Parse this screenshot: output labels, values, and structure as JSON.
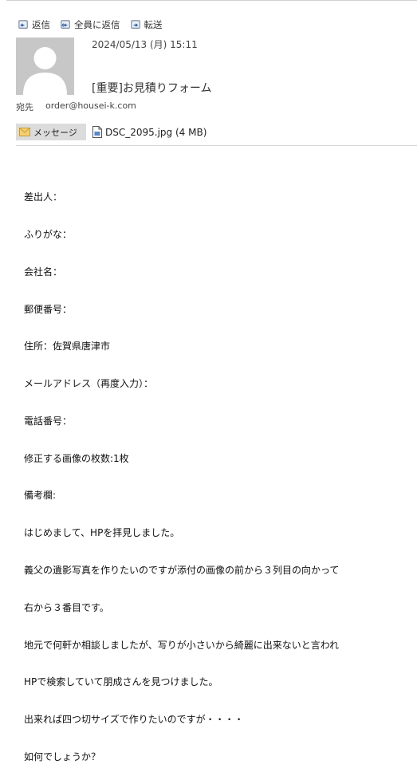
{
  "toolbar": {
    "reply": "返信",
    "reply_all": "全員に返信",
    "forward": "転送"
  },
  "header": {
    "date": "2024/05/13 (月) 15:11",
    "subject": "[重要]お見積りフォーム",
    "to_label": "宛先",
    "to_value": "order@housei-k.com"
  },
  "attachments": {
    "message_tab": "メッセージ",
    "file_label": "DSC_2095.jpg (4 MB)"
  },
  "body": {
    "lines": [
      "差出人：",
      "ふりがな：",
      "会社名：",
      "郵便番号：",
      "住所：佐賀県唐津市",
      "メールアドレス（再度入力）：",
      "電話番号：",
      "修正する画像の枚数:1枚",
      "備考欄:",
      "はじめまして、HPを拝見しました。",
      "義父の遺影写真を作りたいのですが添付の画像の前から３列目の向かって",
      "右から３番目です。",
      "地元で何軒か相談しましたが、写りが小さいから綺麗に出来ないと言われ",
      "HPで検索していて朋成さんを見つけました。",
      "出来れば四つ切サイズで作りたいのですが・・・・",
      "如何でしょうか？"
    ]
  },
  "colors": {
    "avatar_bg": "#c7c7c7",
    "message_tab_bg": "#dcdcdc",
    "envelope_icon": "#e8b94a"
  }
}
